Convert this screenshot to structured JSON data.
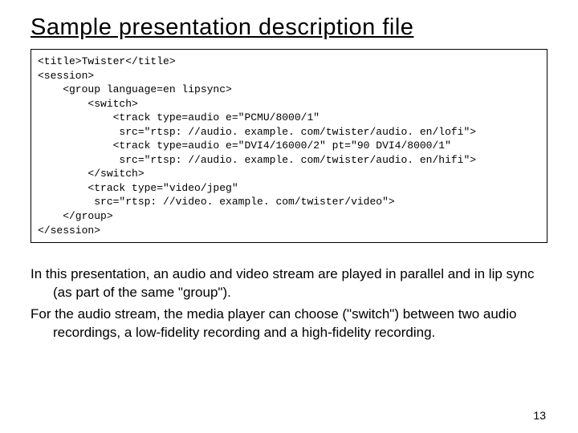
{
  "heading": "Sample presentation description file",
  "code": "<title>Twister</title>\n<session>\n    <group language=en lipsync>\n        <switch>\n            <track type=audio e=\"PCMU/8000/1\"\n             src=\"rtsp: //audio. example. com/twister/audio. en/lofi\">\n            <track type=audio e=\"DVI4/16000/2\" pt=\"90 DVI4/8000/1\"\n             src=\"rtsp: //audio. example. com/twister/audio. en/hifi\">\n        </switch>\n        <track type=\"video/jpeg\"\n         src=\"rtsp: //video. example. com/twister/video\">\n    </group>\n</session>",
  "paragraphs": {
    "p1": "In this presentation, an audio and video stream are played in parallel and in lip sync (as part of the same \"group\").",
    "p2": "For the audio stream, the media player can choose (\"switch\") between two audio recordings, a low-fidelity recording and a high-fidelity recording."
  },
  "page_number": "13"
}
